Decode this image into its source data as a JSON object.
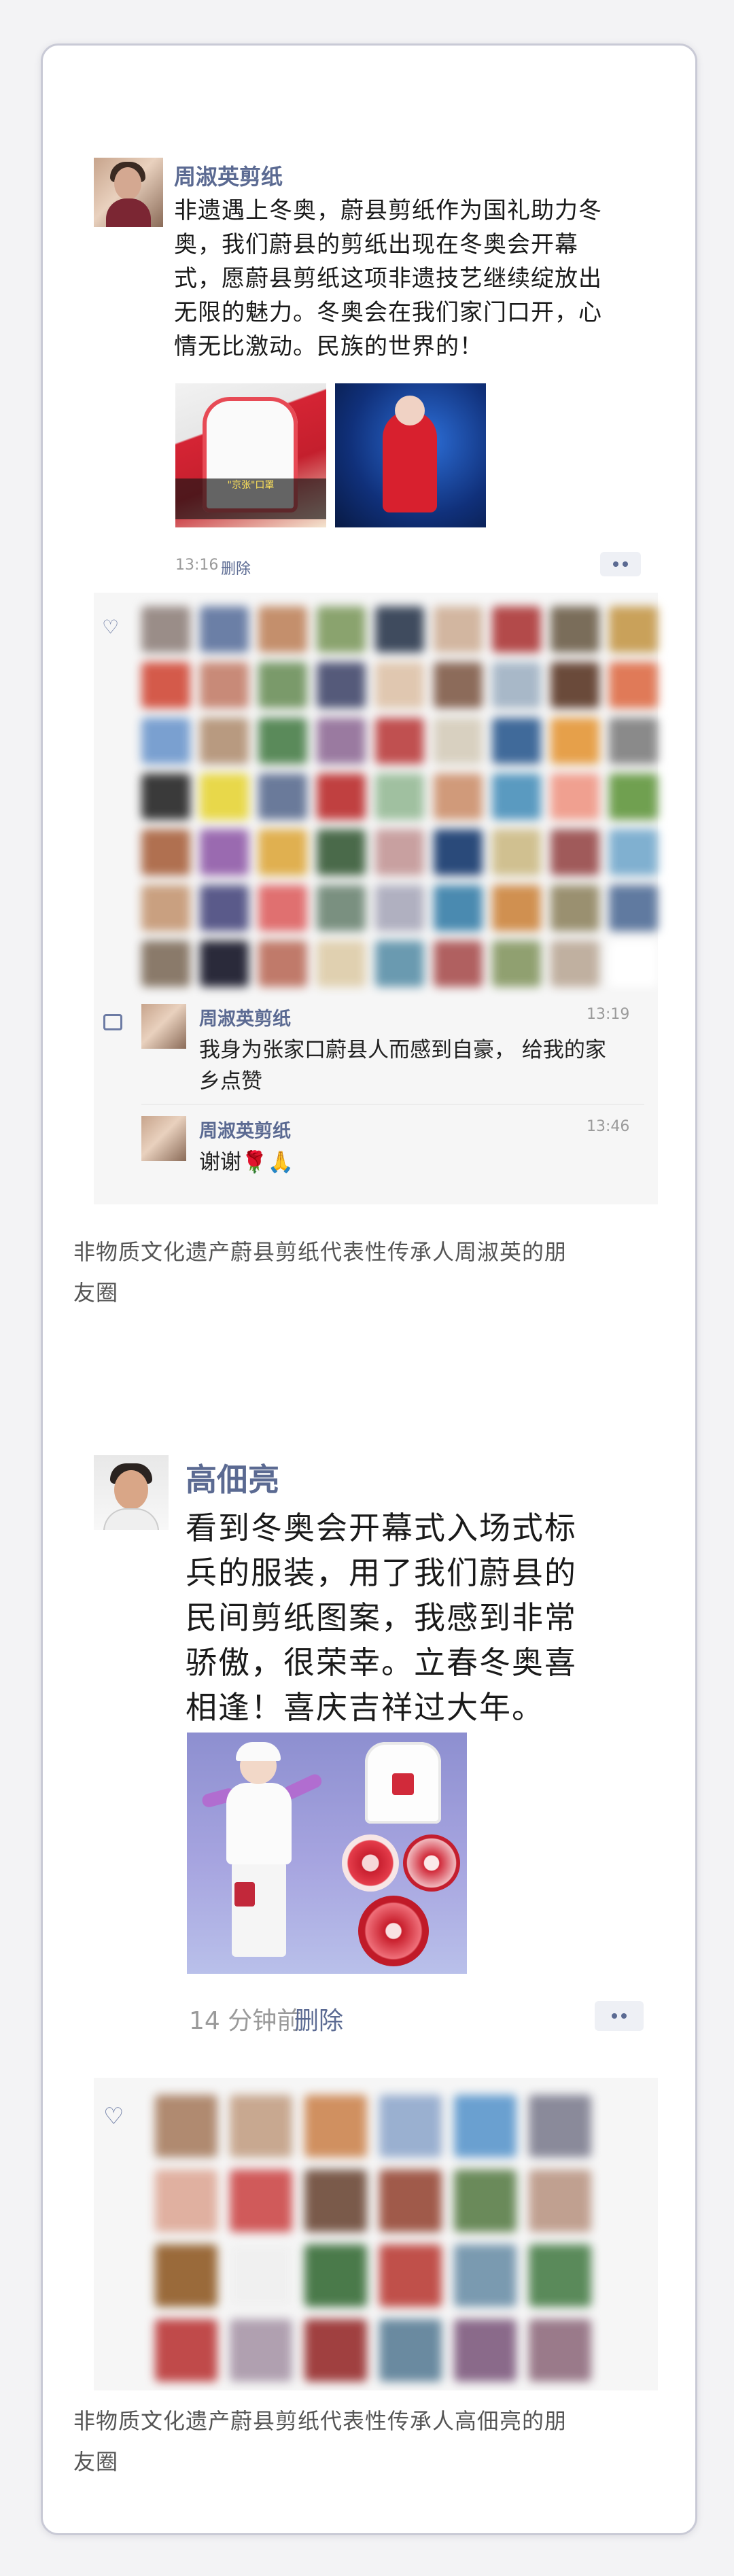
{
  "post1": {
    "author": "周淑英剪纸",
    "text_lines": [
      "非遗遇上冬奥，蔚县剪纸作为国礼助力冬",
      "奥，我们蔚县的剪纸出现在冬奥会开幕",
      "式，愿蔚县剪纸这项非遗技艺继续绽放出",
      "无限的魅力。冬奥会在我们家门口开，心",
      "情无比激动。民族的世界的！"
    ],
    "image1_caption": "\"京张\"口罩",
    "time": "13:16",
    "delete_label": "删除",
    "comments": [
      {
        "name": "周淑英剪纸",
        "time": "13:19",
        "text_lines": [
          "我身为张家口蔚县人而感到自豪， 给我的家",
          "乡点赞"
        ]
      },
      {
        "name": "周淑英剪纸",
        "time": "13:46",
        "text_lines": [
          "谢谢🌹🙏"
        ]
      }
    ],
    "caption_lines": [
      "非物质文化遗产蔚县剪纸代表性传承人周淑英的朋",
      "友圈"
    ]
  },
  "post2": {
    "author": "高佃亮",
    "text_lines": [
      "看到冬奥会开幕式入场式标",
      "兵的服装，用了我们蔚县的",
      "民间剪纸图案，我感到非常",
      "骄傲，很荣幸。立春冬奥喜",
      "相逢！喜庆吉祥过大年。"
    ],
    "time": "14 分钟前",
    "delete_label": "删除",
    "caption_lines": [
      "非物质文化遗产蔚县剪纸代表性传承人高佃亮的朋",
      "友圈"
    ]
  },
  "icons": {
    "like": "heart-icon",
    "comment": "comment-icon",
    "more": "more-dots-icon"
  },
  "colors": {
    "name_link": "#5b6a92",
    "timestamp": "#9a9a9a",
    "interaction_bg": "#f6f6f6"
  }
}
